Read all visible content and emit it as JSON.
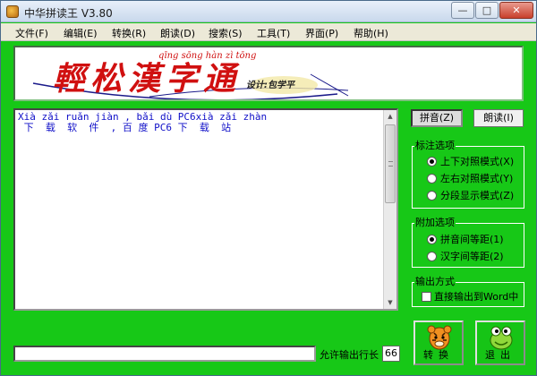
{
  "window": {
    "title": "中华拼读王 V3.80",
    "controls": {
      "minimize": "—",
      "maximize": "□",
      "close": "✕"
    }
  },
  "menu": [
    {
      "label": "文件(F)"
    },
    {
      "label": "编辑(E)"
    },
    {
      "label": "转换(R)"
    },
    {
      "label": "朗读(D)"
    },
    {
      "label": "搜索(S)"
    },
    {
      "label": "工具(T)"
    },
    {
      "label": "界面(P)"
    },
    {
      "label": "帮助(H)"
    }
  ],
  "banner": {
    "title": "輕松漢字通",
    "pinyin": "qīng  sōng   hàn   zì  tōng",
    "designer": "设计:包学平"
  },
  "editor": {
    "line1": "Xià zǎi ruǎn jiàn , bǎi dù PC6xià zǎi zhàn",
    "line2": " 下  载  软  件  , 百 度 PC6 下  载  站"
  },
  "toolbar": {
    "pinyin_button": "拼音(Z)",
    "read_button": "朗读(I)"
  },
  "mark_options": {
    "label": "标注选项",
    "items": [
      {
        "label": "上下对照模式(X)",
        "selected": true
      },
      {
        "label": "左右对照模式(Y)",
        "selected": false
      },
      {
        "label": "分段显示模式(Z)",
        "selected": false
      }
    ]
  },
  "extra_options": {
    "label": "附加选项",
    "items": [
      {
        "label": "拼音间等距(1)",
        "selected": true
      },
      {
        "label": "汉字间等距(2)",
        "selected": false
      }
    ]
  },
  "output": {
    "label": "输出方式",
    "checkbox_label": "直接输出到Word中",
    "checked": false
  },
  "status": {
    "line_length_label": "允许输出行长",
    "line_length_value": "66"
  },
  "actions": {
    "convert_label": "转换",
    "exit_label": "退出"
  },
  "colors": {
    "window_bg": "#17c817",
    "text_blue": "#1010c8",
    "banner_red": "#d01010"
  }
}
